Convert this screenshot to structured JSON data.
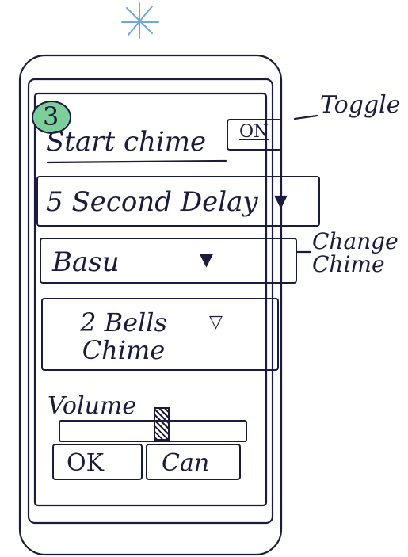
{
  "screen": {
    "step_number": "3",
    "title": "Start chime",
    "toggle_value": "ON",
    "delay_select": "5 Second Delay",
    "sound_select": "Basu",
    "chime_select": "2 Bells Chime",
    "volume_label": "Volume",
    "volume_level_fraction": 0.55,
    "ok_label": "OK",
    "cancel_label": "Can"
  },
  "annotations": {
    "toggle_note": "Toggle",
    "change_chime_note": "Change Chime"
  },
  "colors": {
    "ink": "#1b1b3d",
    "star": "#6fa8dc",
    "badge": "#7dcf9a"
  },
  "icons": {
    "dropdown": "triangle-down-icon",
    "star": "asterisk-icon"
  }
}
